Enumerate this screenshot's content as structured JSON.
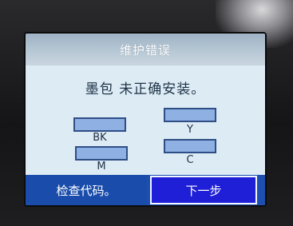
{
  "dialog": {
    "title": "维护错误",
    "message": "墨包 未正确安装。"
  },
  "cartridges": {
    "bk_label": "BK",
    "y_label": "Y",
    "m_label": "M",
    "c_label": "C"
  },
  "buttons": {
    "check_code_label": "检查代码。",
    "next_label": "下一步"
  },
  "colors": {
    "screen_background": "#dcebf4",
    "title_bar": "#b9c9d6",
    "cartridge_fill": "#8fb0e2",
    "cartridge_border": "#2f4e86",
    "footer": "#1a4dab",
    "selected_button": "#1f1fd8"
  }
}
